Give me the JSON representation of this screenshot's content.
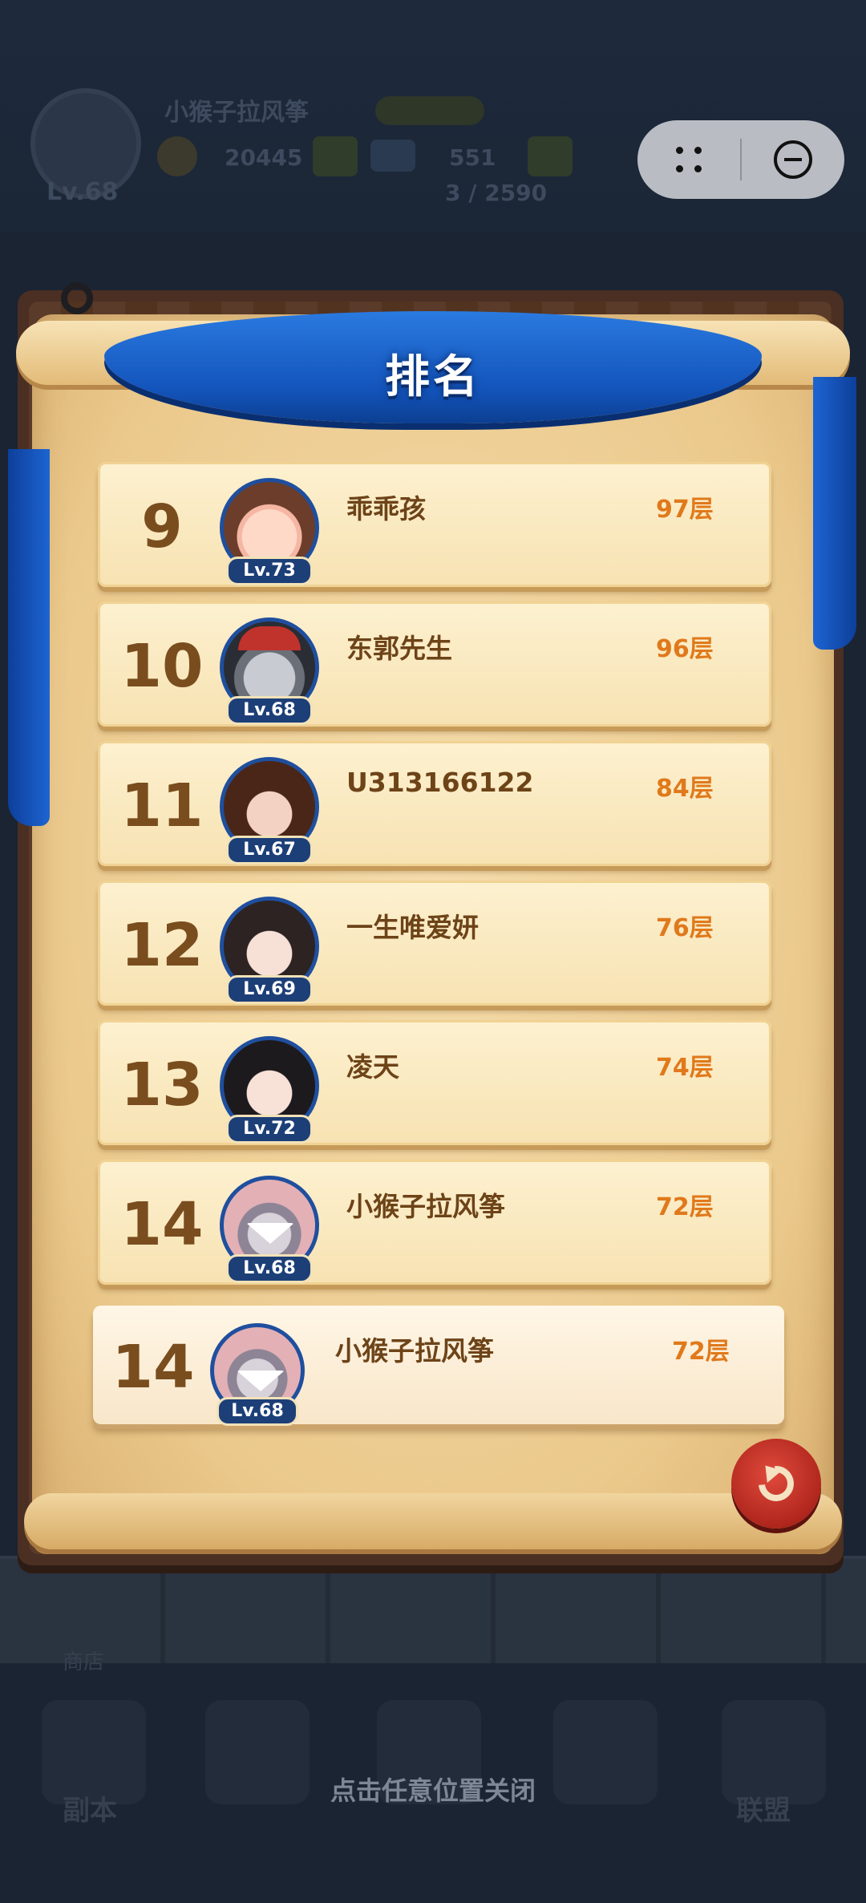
{
  "background": {
    "player_name": "小猴子拉风筝",
    "player_level": "Lv.68",
    "coins": "20445",
    "gems": "551",
    "progress": "3 / 2590",
    "nav": [
      "副本",
      "联盟"
    ],
    "shop": "商店"
  },
  "panel": {
    "title": "排名",
    "close_hint": "点击任意位置关闭",
    "rows": [
      {
        "rank": "9",
        "name": "乖乖孩",
        "level": "Lv.73",
        "floor": "97层",
        "avatar": "cute-girl-avatar"
      },
      {
        "rank": "10",
        "name": "东郭先生",
        "level": "Lv.68",
        "floor": "96层",
        "avatar": "knight-helmet-avatar"
      },
      {
        "rank": "11",
        "name": "U313166122",
        "level": "Lv.67",
        "floor": "84层",
        "avatar": "woman-avatar"
      },
      {
        "rank": "12",
        "name": "一生唯爱妍",
        "level": "Lv.69",
        "floor": "76层",
        "avatar": "woman-avatar"
      },
      {
        "rank": "13",
        "name": "凌天",
        "level": "Lv.72",
        "floor": "74层",
        "avatar": "woman-avatar"
      },
      {
        "rank": "14",
        "name": "小猴子拉风筝",
        "level": "Lv.68",
        "floor": "72层",
        "avatar": "mouse-mask-avatar"
      }
    ],
    "me": {
      "rank": "14",
      "name": "小猴子拉风筝",
      "level": "Lv.68",
      "floor": "72层",
      "avatar": "mouse-mask-avatar"
    }
  },
  "colors": {
    "rank": "#7a4d1e",
    "name": "#6d4318",
    "floor": "#e0791b",
    "banner": "#1354bb"
  }
}
